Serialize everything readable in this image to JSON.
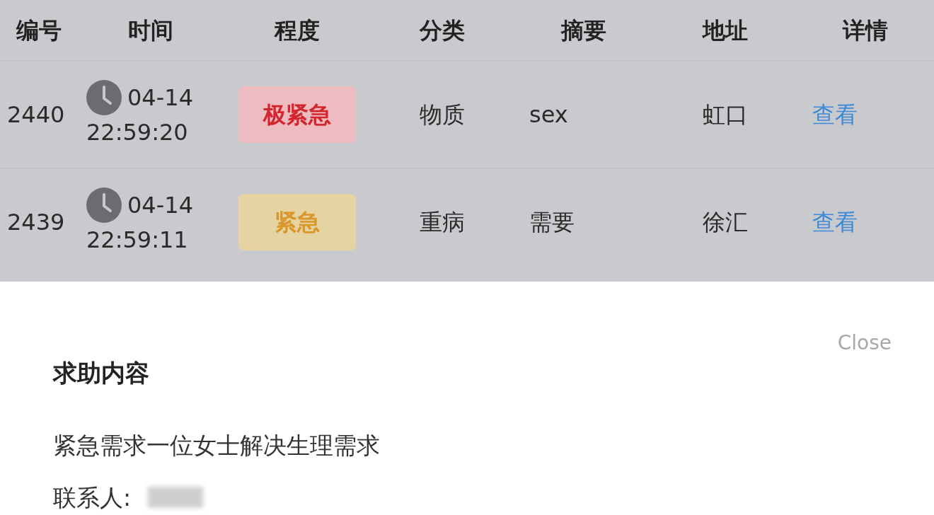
{
  "table": {
    "columns": [
      "编号",
      "时间",
      "程度",
      "分类",
      "摘要",
      "地址",
      "详情"
    ],
    "rows": [
      {
        "id": "2440",
        "date": "04-14",
        "time": "22:59:20",
        "level": {
          "label": "极紧急",
          "kind": "critical"
        },
        "category": "物质",
        "summary": "sex",
        "district": "虹口",
        "action": "查看"
      },
      {
        "id": "2439",
        "date": "04-14",
        "time": "22:59:11",
        "level": {
          "label": "紧急",
          "kind": "urgent"
        },
        "category": "重病",
        "summary": "需要",
        "district": "徐汇",
        "action": "查看"
      }
    ]
  },
  "sheet": {
    "close": "Close",
    "title": "求助内容",
    "content": "紧急需求一位女士解决生理需求",
    "contact_label": "联系人:"
  }
}
